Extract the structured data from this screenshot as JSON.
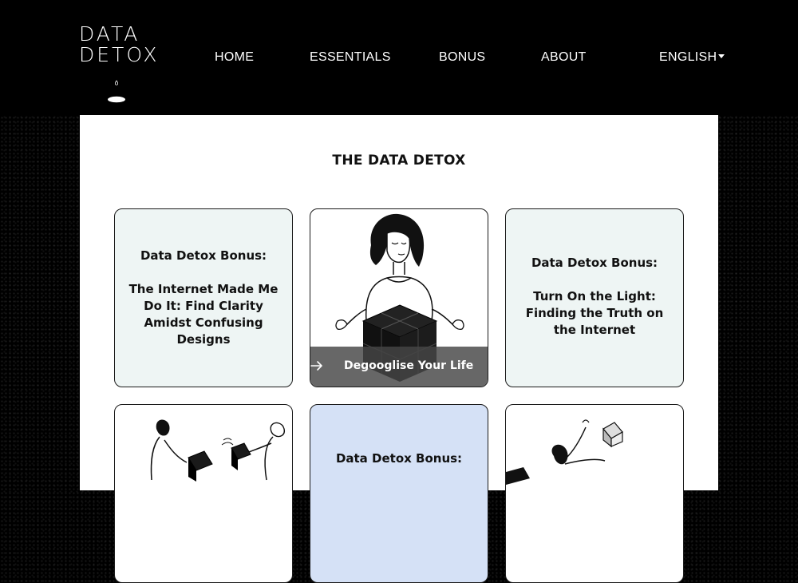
{
  "logo": {
    "line1": "DATA",
    "line2": "DETOX"
  },
  "nav": {
    "items": [
      "HOME",
      "ESSENTIALS",
      "BONUS",
      "ABOUT"
    ],
    "language": "ENGLISH"
  },
  "page_title": "THE DATA DETOX",
  "cards": {
    "c1": {
      "kicker": "Data Detox Bonus:",
      "title": "The Internet Made Me Do It: Find Clarity Amidst Confusing Designs"
    },
    "c2": {
      "label": "Degooglise Your Life"
    },
    "c3": {
      "kicker": "Data Detox Bonus:",
      "title": "Turn On the Light: Finding the Truth on the Internet"
    },
    "c5": {
      "kicker": "Data Detox Bonus:"
    }
  },
  "icons": {
    "arrow": "arrow-right-icon",
    "caret": "caret-down-icon",
    "logo_mark": "droplet-icon"
  },
  "colors": {
    "header_bg": "#000000",
    "card_mint": "#eef5f4",
    "card_blue": "#d5e1f6",
    "overlay": "#464646"
  }
}
